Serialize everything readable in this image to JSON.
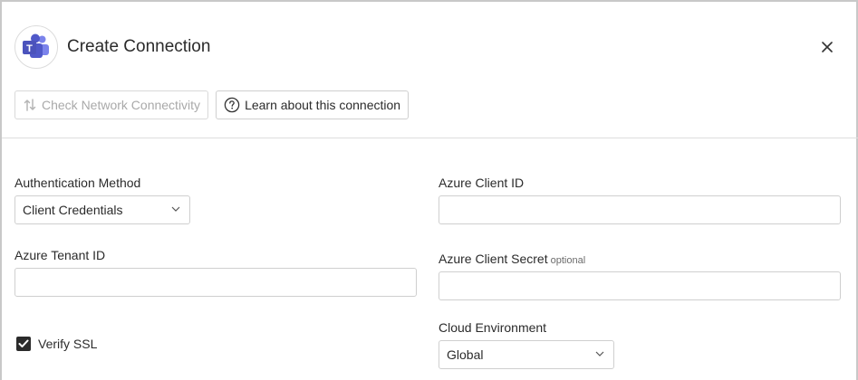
{
  "header": {
    "title": "Create Connection",
    "logo_icon": "microsoft-teams-icon",
    "close_icon": "close-icon"
  },
  "toolbar": {
    "check_network_label": "Check Network Connectivity",
    "check_network_icon": "network-check-icon",
    "learn_label": "Learn about this connection",
    "learn_icon": "help-circle-icon"
  },
  "form": {
    "auth_method": {
      "label": "Authentication Method",
      "value": "Client Credentials"
    },
    "azure_client_id": {
      "label": "Azure Client ID",
      "value": ""
    },
    "azure_tenant_id": {
      "label": "Azure Tenant ID",
      "value": ""
    },
    "azure_client_secret": {
      "label": "Azure Client Secret",
      "optional_tag": "optional",
      "value": ""
    },
    "verify_ssl": {
      "label": "Verify SSL",
      "checked": true
    },
    "cloud_environment": {
      "label": "Cloud Environment",
      "value": "Global"
    }
  },
  "colors": {
    "teams_purple": "#5059C9",
    "teams_purple_light": "#7B83EB",
    "border": "#cfcfcf",
    "text": "#2b2b2b",
    "disabled_text": "#a9a9a9"
  }
}
